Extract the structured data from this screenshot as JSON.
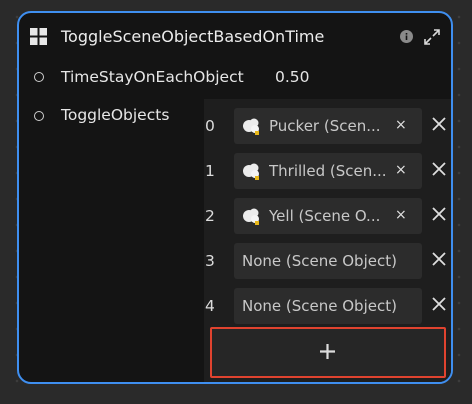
{
  "node": {
    "title": "ToggleSceneObjectBasedOnTime",
    "icons": {
      "node": "grid-icon",
      "info": "info-icon",
      "expand": "expand-icon"
    }
  },
  "properties": {
    "time_stay": {
      "label": "TimeStayOnEachObject",
      "value": "0.50"
    },
    "toggle_objects": {
      "label": "ToggleObjects"
    }
  },
  "list": {
    "rows": [
      {
        "index": "0",
        "value": "Pucker (Scen...",
        "has_icon": true,
        "clear": "×"
      },
      {
        "index": "1",
        "value": "Thrilled (Scen...",
        "has_icon": true,
        "clear": "×"
      },
      {
        "index": "2",
        "value": "Yell (Scene O...",
        "has_icon": true,
        "clear": "×"
      },
      {
        "index": "3",
        "value": "None (Scene Object)",
        "has_icon": false
      },
      {
        "index": "4",
        "value": "None (Scene Object)",
        "has_icon": false
      }
    ],
    "add_icon": "plus-icon"
  },
  "colors": {
    "node_border": "#3f8ff0",
    "highlight": "#e0432f",
    "background": "#2a2a2a"
  }
}
